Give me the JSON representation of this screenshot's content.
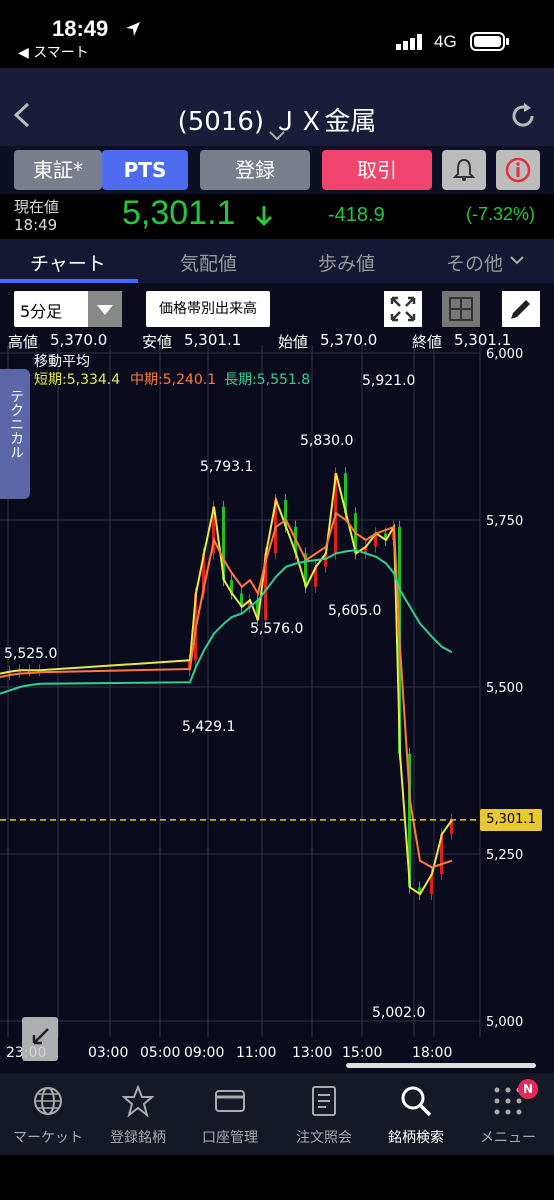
{
  "status_bar": {
    "time": "18:49",
    "back_label": "◀ スマート",
    "network": "4G"
  },
  "header": {
    "title": "(5016) ＪＸ金属"
  },
  "actions": {
    "exchange_tse": "東証*",
    "exchange_pts": "PTS",
    "register": "登録",
    "trade": "取引"
  },
  "quote": {
    "label": "現在値",
    "time": "18:49",
    "price": "5,301.1",
    "change": "-418.9",
    "change_pct": "(-7.32%)"
  },
  "tabs": [
    "チャート",
    "気配値",
    "歩み値",
    "その他"
  ],
  "chart_toolbar": {
    "interval": "5分足",
    "volume_button": "価格帯別出来高"
  },
  "ohlc": {
    "high_label": "高値",
    "high": "5,370.0",
    "low_label": "安値",
    "low": "5,301.1",
    "open_label": "始値",
    "open": "5,370.0",
    "close_label": "終値",
    "close": "5,301.1"
  },
  "technical_tab": "テクニカル",
  "chart_data": {
    "type": "line",
    "ma_title": "移動平均",
    "ma_short": "短期:5,334.4",
    "ma_mid": "中期:5,240.1",
    "ma_long": "長期:5,551.8",
    "colors": {
      "short": "#e8e84a",
      "mid": "#ff7a3c",
      "long": "#2fd18f",
      "up": "#e02020",
      "down": "#20c020",
      "grid": "#303548",
      "current": "#e8c830"
    },
    "y_ticks": [
      "6,000",
      "5,750",
      "5,500",
      "5,250",
      "5,000"
    ],
    "x_ticks": [
      "23:00",
      "03:00",
      "05:00",
      "09:00",
      "11:00",
      "13:00",
      "15:00",
      "18:00"
    ],
    "current_price_tag": "5,301.1",
    "current_price": 5301.1,
    "annotations": [
      "5,525.0",
      "5,921.0",
      "5,830.0",
      "5,793.1",
      "5,576.0",
      "5,605.0",
      "5,429.1",
      "5,002.0"
    ],
    "ylim": [
      5000,
      6000
    ],
    "series": [
      {
        "name": "短期",
        "values": [
          5520,
          5523,
          5525,
          5525,
          5525,
          5540,
          5640,
          5700,
          5770,
          5660,
          5640,
          5620,
          5630,
          5600,
          5700,
          5780,
          5740,
          5700,
          5650,
          5680,
          5700,
          5820,
          5760,
          5700,
          5710,
          5730,
          5720,
          5740,
          5400,
          5200,
          5190,
          5220,
          5280,
          5301
        ]
      },
      {
        "name": "中期",
        "values": [
          5515,
          5518,
          5520,
          5521,
          5522,
          5527,
          5590,
          5650,
          5720,
          5690,
          5670,
          5650,
          5660,
          5640,
          5690,
          5740,
          5750,
          5720,
          5690,
          5700,
          5710,
          5760,
          5750,
          5730,
          5720,
          5730,
          5735,
          5740,
          5560,
          5330,
          5240,
          5230,
          5235,
          5240
        ]
      },
      {
        "name": "長期",
        "values": [
          5490,
          5495,
          5500,
          5503,
          5505,
          5507,
          5530,
          5555,
          5580,
          5595,
          5605,
          5610,
          5620,
          5630,
          5645,
          5665,
          5680,
          5685,
          5688,
          5690,
          5692,
          5700,
          5703,
          5705,
          5700,
          5695,
          5685,
          5670,
          5645,
          5620,
          5595,
          5575,
          5560,
          5552
        ]
      }
    ]
  },
  "nav": [
    "マーケット",
    "登録銘柄",
    "口座管理",
    "注文照会",
    "銘柄検索",
    "メニュー"
  ],
  "nav_badge": "N"
}
